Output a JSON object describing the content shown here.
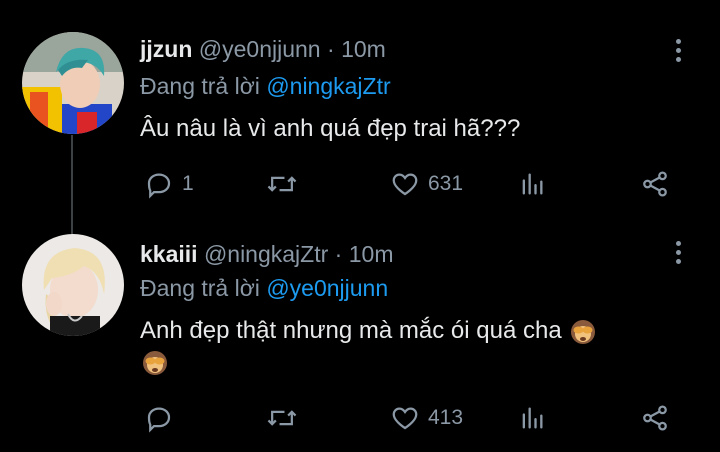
{
  "tweets": [
    {
      "name": "jjzun",
      "handle": "@ye0njjunn",
      "separator": "·",
      "time": "10m",
      "reply_prefix": "Đang trả lời",
      "reply_to": "@ningkajZtr",
      "text": "Âu nâu là vì anh quá đẹp trai hã???",
      "replies": "1",
      "retweets": "",
      "likes": "631"
    },
    {
      "name": "kkaiii",
      "handle": "@ningkajZtr",
      "separator": "·",
      "time": "10m",
      "reply_prefix": "Đang trả lời",
      "reply_to": "@ye0njjunn",
      "text": "Anh đẹp thật nhưng mà mắc ói quá cha",
      "replies": "",
      "retweets": "",
      "likes": "413"
    }
  ],
  "icons": {
    "reply": "reply-icon",
    "retweet": "retweet-icon",
    "like": "heart-icon",
    "stats": "stats-icon",
    "share": "share-icon",
    "more": "more-vertical-icon",
    "emoji": "see-no-evil-monkey-emoji"
  },
  "colors": {
    "background": "#000000",
    "text": "#e7e9ea",
    "muted": "#8b98a5",
    "mention": "#1d9bf0",
    "thread_line": "#3e4144"
  }
}
